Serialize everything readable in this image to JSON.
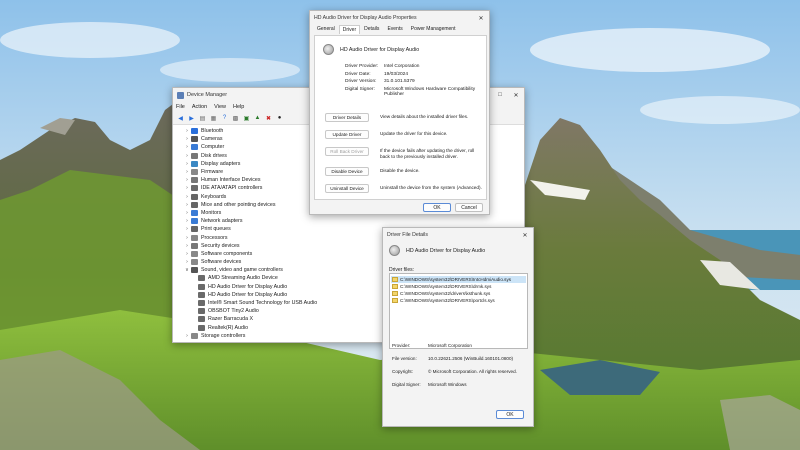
{
  "colors": {
    "sky": "#b6d6ee",
    "mountain": "#5f6a43",
    "grass": "#7ca43a",
    "rock": "#8a8a86",
    "water": "#4a95b8",
    "accent": "#0067c0"
  },
  "device_manager": {
    "title": "Device Manager",
    "menu": [
      "File",
      "Action",
      "View",
      "Help"
    ],
    "categories": [
      {
        "label": "Bluetooth",
        "color": "#2a6fdb"
      },
      {
        "label": "Cameras",
        "color": "#555"
      },
      {
        "label": "Computer",
        "color": "#3a7bd5"
      },
      {
        "label": "Disk drives",
        "color": "#777"
      },
      {
        "label": "Display adapters",
        "color": "#3b88c3"
      },
      {
        "label": "Firmware",
        "color": "#888"
      },
      {
        "label": "Human Interface Devices",
        "color": "#777"
      },
      {
        "label": "IDE ATA/ATAPI controllers",
        "color": "#6b6b6b"
      },
      {
        "label": "Keyboards",
        "color": "#666"
      },
      {
        "label": "Mice and other pointing devices",
        "color": "#666"
      },
      {
        "label": "Monitors",
        "color": "#3a7bd5"
      },
      {
        "label": "Network adapters",
        "color": "#3a7bd5"
      },
      {
        "label": "Print queues",
        "color": "#666"
      },
      {
        "label": "Processors",
        "color": "#888"
      },
      {
        "label": "Security devices",
        "color": "#777"
      },
      {
        "label": "Software components",
        "color": "#888"
      },
      {
        "label": "Software devices",
        "color": "#888"
      },
      {
        "label": "Sound, video and game controllers",
        "color": "#555"
      }
    ],
    "sound_children": [
      "AMD Streaming Audio Device",
      "HD Audio Driver for Display Audio",
      "HD Audio Driver for Display Audio",
      "Intel® Smart Sound Technology for USB Audio",
      "OBSBOT Tiny2 Audio",
      "Razer Barracuda X",
      "Realtek(R) Audio"
    ],
    "last_category": "Storage controllers"
  },
  "props": {
    "title": "HD Audio Driver for Display Audio Properties",
    "tabs": [
      "General",
      "Driver",
      "Details",
      "Events",
      "Power Management"
    ],
    "active_tab": "Driver",
    "device_name": "HD Audio Driver for Display Audio",
    "fields": [
      {
        "key": "Driver Provider:",
        "value": "Intel Corporation"
      },
      {
        "key": "Driver Date:",
        "value": "19/03/2024"
      },
      {
        "key": "Driver Version:",
        "value": "31.0.101.5379"
      },
      {
        "key": "Digital Signer:",
        "value": "Microsoft Windows Hardware Compatibility Publisher"
      }
    ],
    "actions": [
      {
        "button": "Driver Details",
        "desc": "View details about the installed driver files."
      },
      {
        "button": "Update Driver",
        "desc": "Update the driver for this device."
      },
      {
        "button": "Roll Back Driver",
        "desc": "If the device fails after updating the driver, roll back to the previously installed driver."
      },
      {
        "button": "Disable Device",
        "desc": "Disable the device."
      },
      {
        "button": "Uninstall Device",
        "desc": "Uninstall the device from the system (Advanced)."
      }
    ],
    "ok": "OK",
    "cancel": "Cancel"
  },
  "file_details": {
    "title": "Driver File Details",
    "device_name": "HD Audio Driver for Display Audio",
    "files_label": "Driver files:",
    "files": [
      "C:\\WINDOWS\\system32\\DRIVERS\\IntcHdmiAudio.sys",
      "C:\\WINDOWS\\system32\\DRIVERS\\drmk.sys",
      "C:\\WINDOWS\\system32\\drivers\\ksthunk.sys",
      "C:\\WINDOWS\\system32\\DRIVERS\\portcls.sys"
    ],
    "info": [
      {
        "key": "Provider:",
        "value": "Microsoft Corporation"
      },
      {
        "key": "File version:",
        "value": "10.0.22621.2506 (WinBuild.160101.0800)"
      },
      {
        "key": "Copyright:",
        "value": "© Microsoft Corporation. All rights reserved."
      },
      {
        "key": "Digital Signer:",
        "value": "Microsoft Windows"
      }
    ],
    "ok": "OK"
  }
}
